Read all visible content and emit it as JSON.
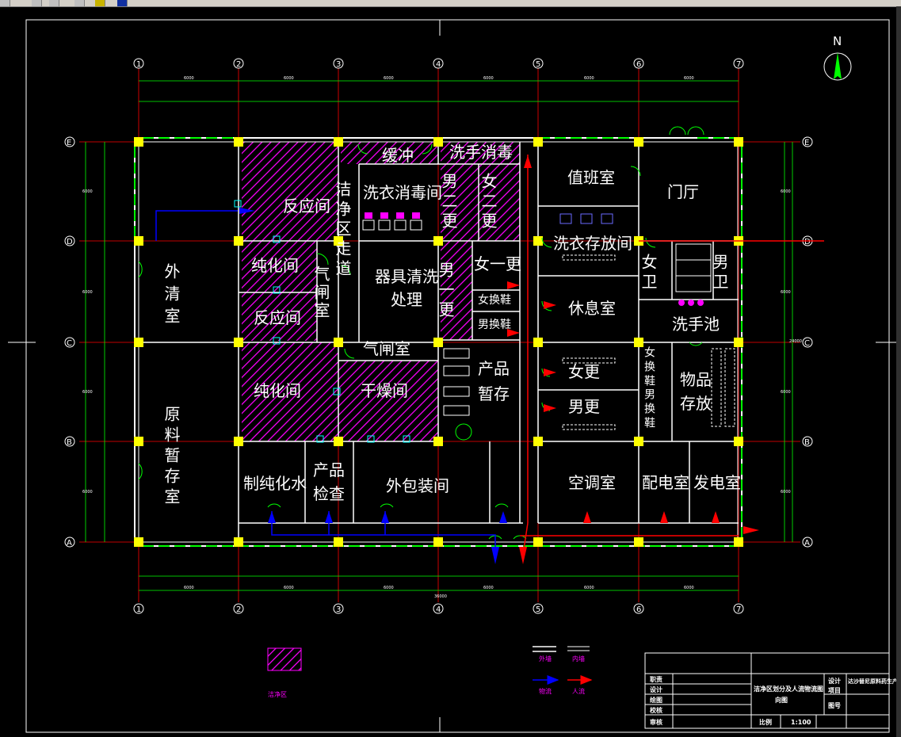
{
  "axes": {
    "x": [
      "1",
      "2",
      "3",
      "4",
      "5",
      "6",
      "7"
    ],
    "y": [
      "E",
      "D",
      "C",
      "B",
      "A"
    ]
  },
  "north": "N",
  "dimensions": {
    "top": [
      "6000",
      "6000",
      "6000",
      "6000",
      "6000",
      "6000"
    ],
    "total": "36000",
    "left": [
      "6000",
      "6000",
      "6000",
      "6000"
    ],
    "right": [
      "6000",
      "6000",
      "6000",
      "6000"
    ],
    "right_total": "24000"
  },
  "rooms": {
    "wai_qing_shi": "外清室",
    "yuan_liao": "原料暂存室",
    "fan_ying_1": "反应间",
    "chun_hua_1": "纯化间",
    "fan_ying_2": "反应间",
    "chun_hua_2": "纯化间",
    "qi_zha_1": "气闸室",
    "jie_jing_zou_dao": "洁净区走道",
    "huan_chong": "缓冲",
    "xi_yi_xiao_du": "洗衣消毒间",
    "xi_shou_xiao_du": "洗手消毒",
    "nan_er_geng": "男二更",
    "nv_er_geng": "女二更",
    "qi_ju_qing_xi": [
      "器具清洗",
      "处理"
    ],
    "nan_yi_geng": "男一更",
    "nv_yi_geng": "女一更",
    "nv_huan_xie": "女换鞋",
    "nan_huan_xie": "男换鞋",
    "qi_zha_2": "气闸室",
    "gan_zao": "干燥间",
    "chan_pin_zan_cun": [
      "产品",
      "暂存"
    ],
    "zhi_chun_hua_shui": "制纯化水",
    "chan_pin_jian_cha": [
      "产品",
      "检查"
    ],
    "wai_bao_zhuang": "外包装间",
    "zhi_ban": "值班室",
    "men_ting": "门厅",
    "xi_yi_cun_fang": "洗衣存放间",
    "nv_wei": "女卫",
    "nan_wei": "男卫",
    "xiu_xi": "休息室",
    "xi_shou_chi": "洗手池",
    "nv_geng": "女更",
    "nan_geng": "男更",
    "nv_huan_xie_2": "女换鞋",
    "nan_huan_xie_2": "男换鞋",
    "wu_pin_cun_fang": [
      "物品",
      "存放"
    ],
    "kong_tiao": "空调室",
    "pei_dian": "配电室",
    "fa_dian": "发电室"
  },
  "legend": {
    "hatch_label": "洁净区",
    "wai_qiang": "外墙",
    "nei_qiang": "内墙",
    "wu_liu": "物流",
    "ren_liu": "人流"
  },
  "title_block": {
    "rows": [
      "职责",
      "设计",
      "绘图",
      "校核",
      "审核"
    ],
    "drawing_title": "洁净区划分及人流物流图",
    "drawing_sub": "向图",
    "design_label": "设计",
    "project_label": "项目",
    "project_name": "达沙替尼原料药生产车间设计",
    "drawing_no_label": "图号",
    "scale_label": "比例",
    "scale_value": "1:100"
  },
  "colors": {
    "wall": "#ffffff",
    "outer_wall": "#00ff00",
    "column": "#ffff00",
    "hatch": "#ff00ff",
    "axis_line": "#ff0000",
    "dim_line": "#00ff00",
    "people_flow": "#ff0000",
    "material_flow": "#0000ff"
  }
}
